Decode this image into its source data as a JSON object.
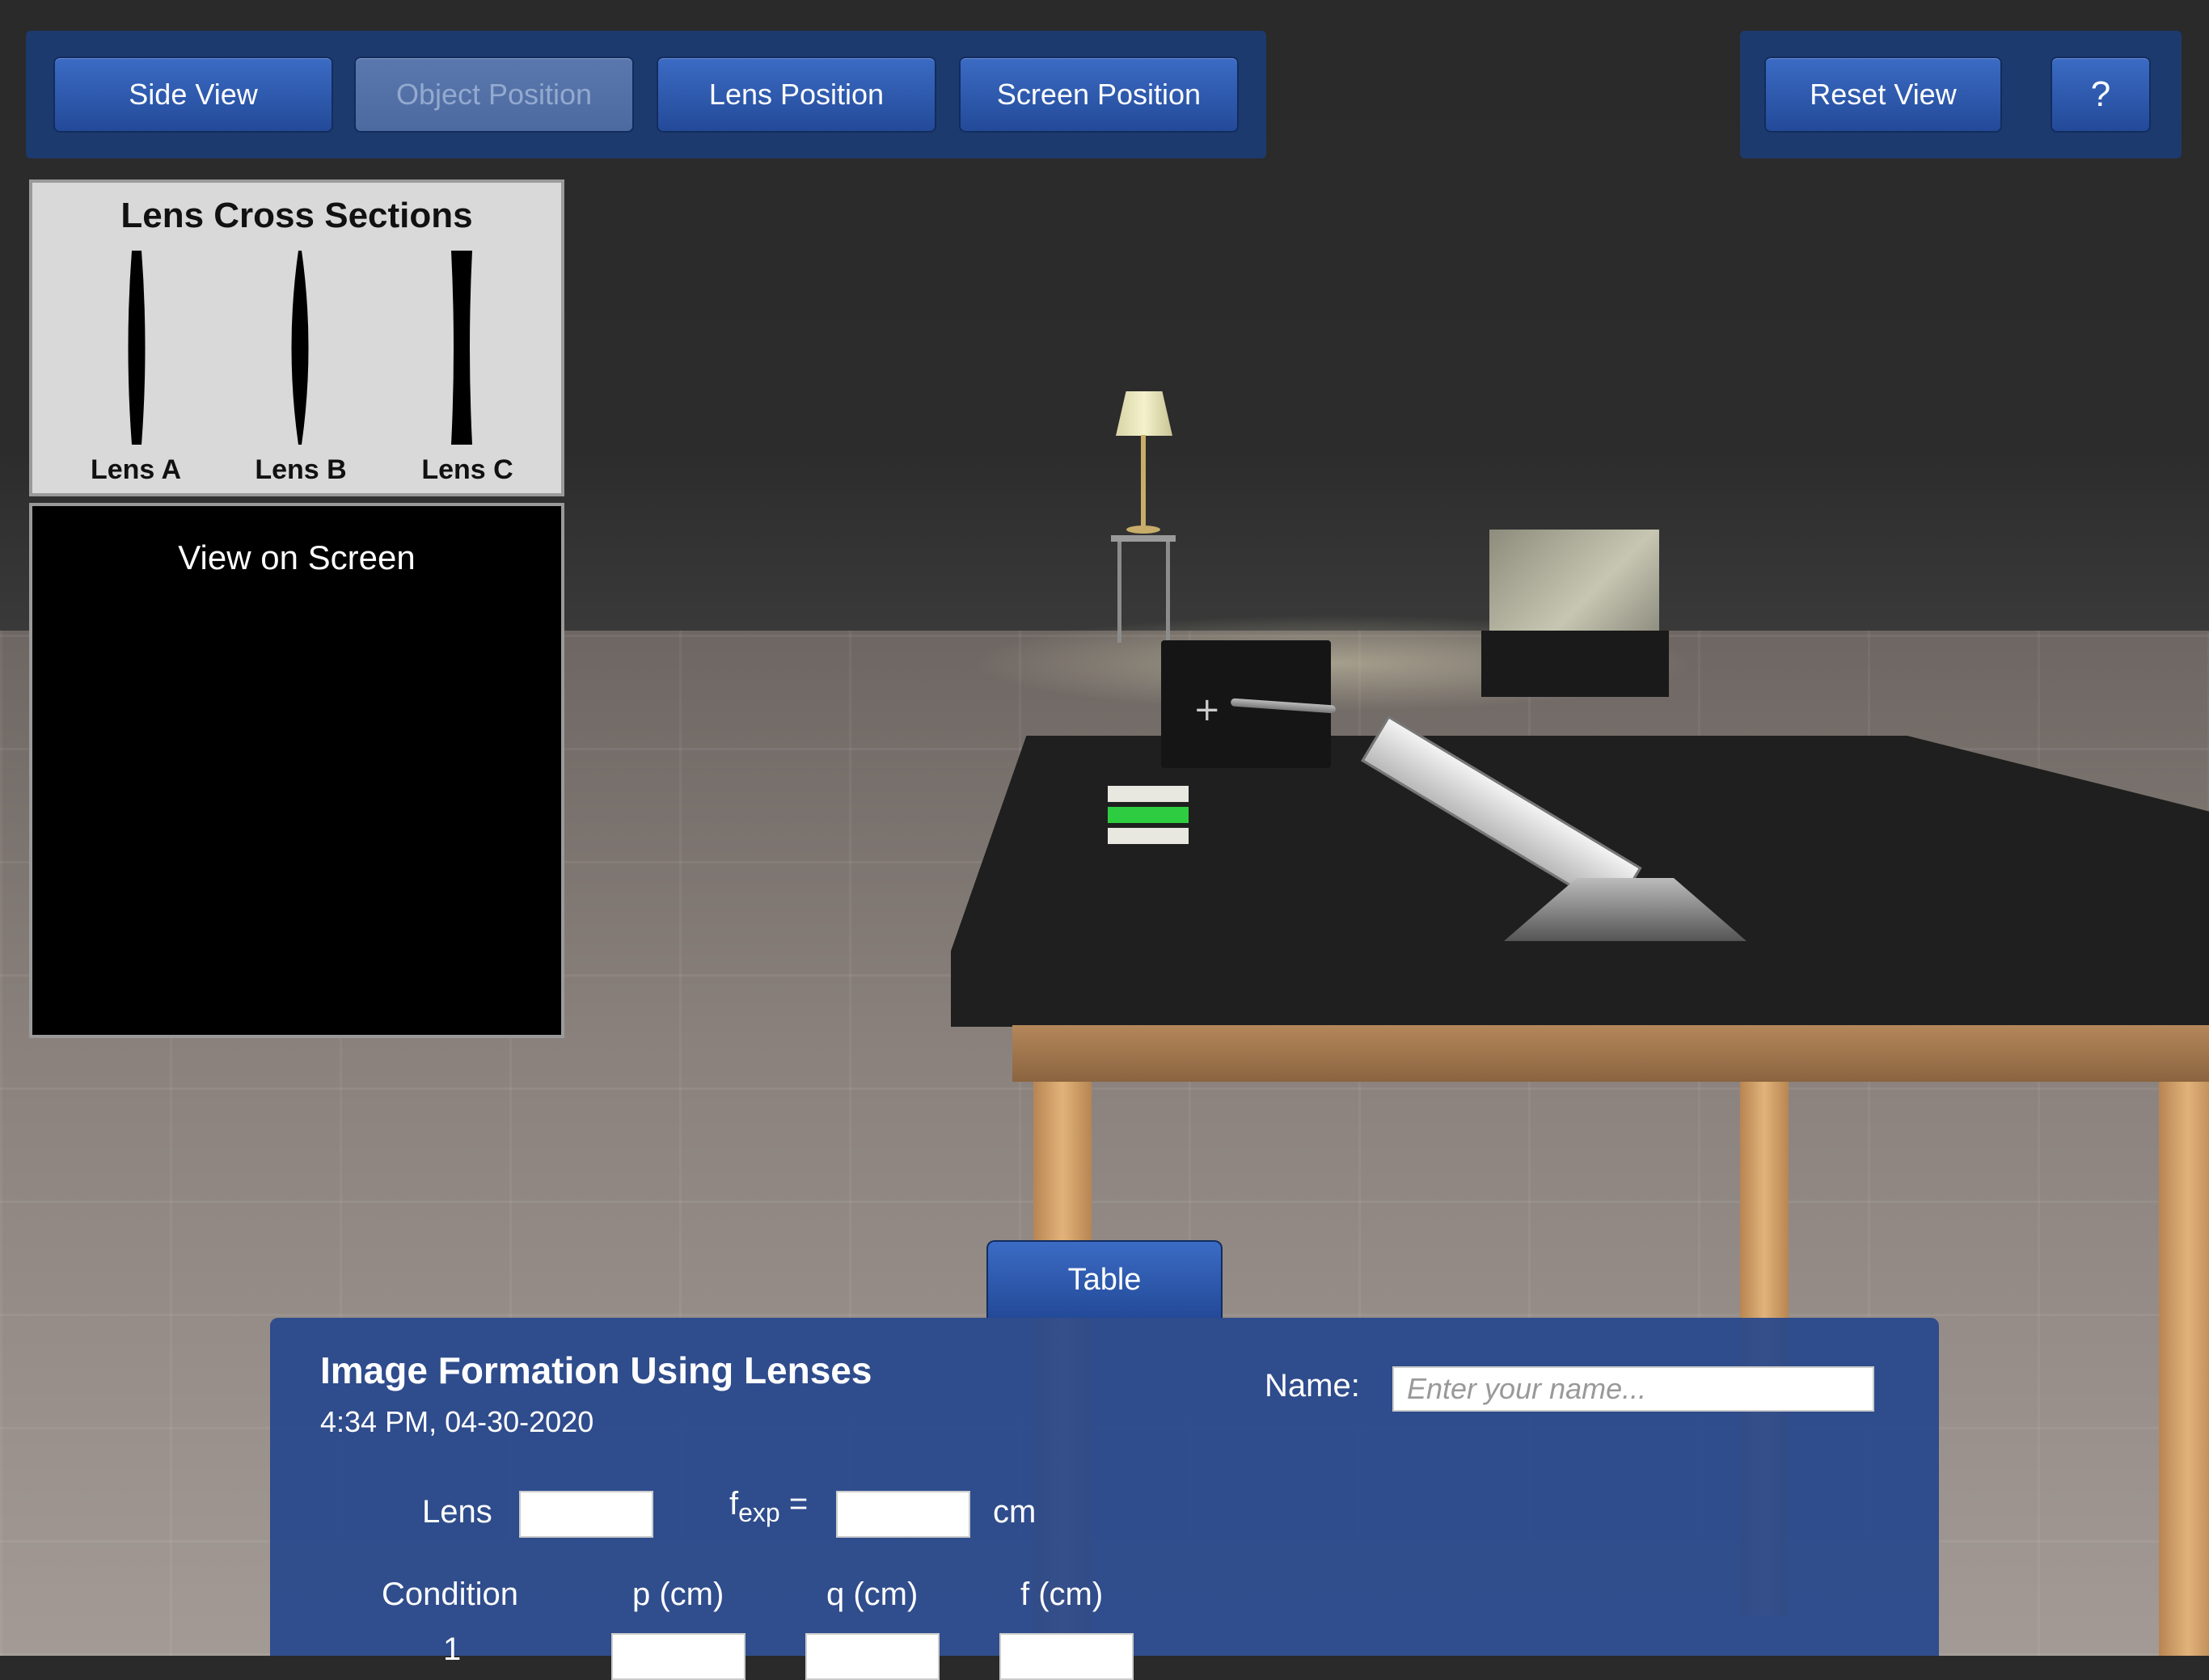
{
  "toolbar": {
    "side_view": "Side View",
    "object_position": "Object Position",
    "lens_position": "Lens Position",
    "screen_position": "Screen Position",
    "reset_view": "Reset View",
    "help": "?"
  },
  "lens_panel": {
    "title": "Lens Cross Sections",
    "lenses": [
      {
        "label": "Lens A"
      },
      {
        "label": "Lens B"
      },
      {
        "label": "Lens C"
      }
    ]
  },
  "view_panel": {
    "title": "View on Screen"
  },
  "table": {
    "tab_label": "Table",
    "title": "Image Formation Using Lenses",
    "timestamp": "4:34 PM, 04-30-2020",
    "name_label": "Name:",
    "name_placeholder": "Enter your name...",
    "lens_label": "Lens",
    "fexp_label": "f",
    "fexp_sub": "exp",
    "fexp_eq": "=",
    "unit": "cm",
    "columns": [
      "Condition",
      "p (cm)",
      "q (cm)",
      "f (cm)"
    ],
    "first_row_number": "1"
  },
  "colors": {
    "button": "#2d5bb0",
    "panel": "#26468c",
    "accent_green": "#2ecc40"
  }
}
